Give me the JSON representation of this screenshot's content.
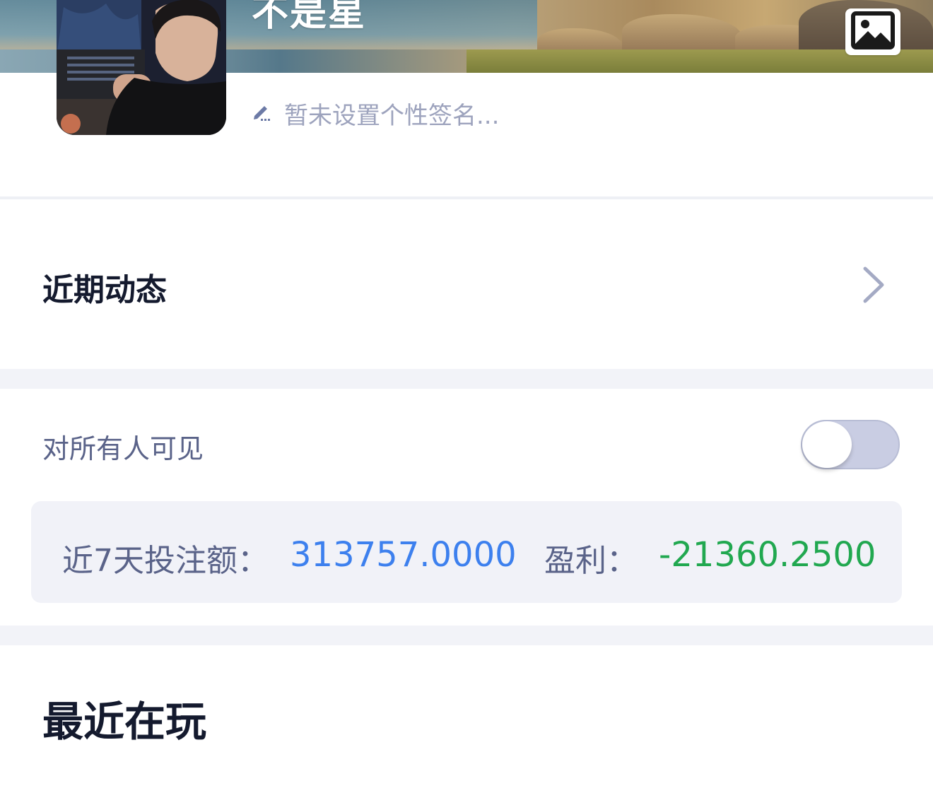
{
  "header": {
    "username": "不是星",
    "signature_placeholder": "暂未设置个性签名..."
  },
  "icons": {
    "background_image": "image-icon",
    "edit": "pencil-icon",
    "chevron": "chevron-right-icon"
  },
  "recent_activity": {
    "title": "近期动态"
  },
  "visibility": {
    "label": "对所有人可见",
    "enabled": false
  },
  "stats": {
    "bet_label": "近7天投注额：",
    "bet_value": "313757.0000",
    "profit_label": "盈利：",
    "profit_value": "-21360.2500"
  },
  "recent_playing": {
    "title": "最近在玩"
  },
  "colors": {
    "accent_blue": "#3d80ee",
    "profit_green": "#21a850",
    "label_gray": "#5a6389",
    "toggle_off": "#c9cde3"
  }
}
